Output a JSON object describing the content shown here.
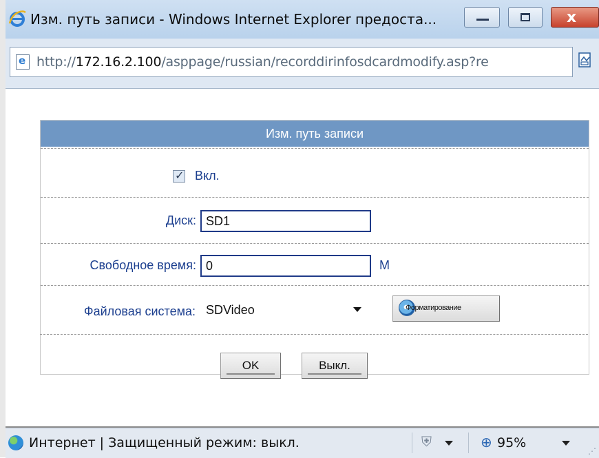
{
  "window": {
    "title": "Изм. путь записи - Windows Internet Explorer предоста...",
    "close_glyph": "x"
  },
  "address": {
    "url_prefix": "http://",
    "url_host": "172.16.2.100",
    "url_path": "/asppage/russian/recorddirinfosdcardmodify.asp?re"
  },
  "dialog": {
    "header": "Изм. путь записи",
    "enable_label": "Вкл.",
    "enable_checked": true,
    "disk_label": "Диск:",
    "disk_value": "SD1",
    "free_time_label": "Свободное время:",
    "free_time_value": "0",
    "free_time_unit": "M",
    "fs_label": "Файловая система:",
    "fs_selected": "SDVideo",
    "format_button": "Форматирование",
    "ok_button": "OK",
    "off_button": "Выкл."
  },
  "status": {
    "zone_text": "Интернет | Защищенный режим: выкл.",
    "zoom": "95%"
  },
  "colors": {
    "header_bg": "#6f97c4",
    "label_color": "#1c3f8f",
    "input_border": "#1f3a88"
  }
}
